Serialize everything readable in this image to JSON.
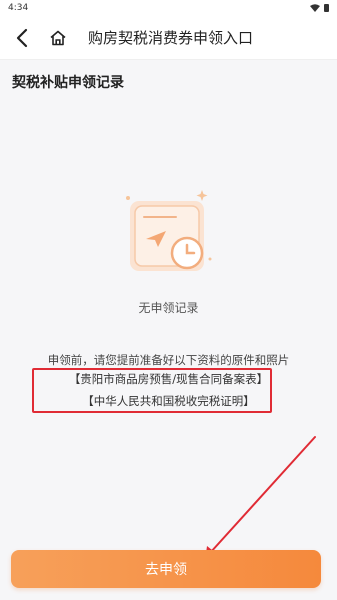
{
  "status_bar": {
    "time": "4:34"
  },
  "nav": {
    "title": "购房契税消费券申领入口"
  },
  "section": {
    "title": "契税补贴申领记录"
  },
  "empty_state": {
    "text": "无申领记录"
  },
  "notice": {
    "line1": "申领前，请您提前准备好以下资料的原件和照片",
    "doc1": "【贵阳市商品房预售/现售合同备案表】",
    "doc2": "【中华人民共和国税收完税证明】"
  },
  "apply_button": {
    "label": "去申领"
  },
  "colors": {
    "accent_orange": "#f5893c",
    "highlight_red": "#e02b35"
  }
}
